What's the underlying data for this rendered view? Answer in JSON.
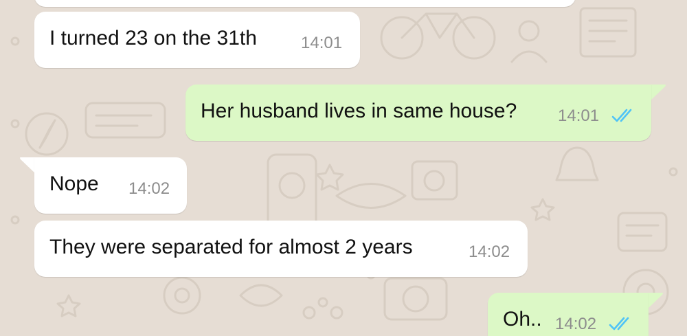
{
  "messages": [
    {
      "direction": "in",
      "text": "I turned 23 on the 31th",
      "time": "14:01"
    },
    {
      "direction": "out",
      "text": "Her husband lives in same house?",
      "time": "14:01",
      "status": "read"
    },
    {
      "direction": "in",
      "text": "Nope",
      "time": "14:02"
    },
    {
      "direction": "in",
      "text": "They were separated for almost 2 years",
      "time": "14:02"
    },
    {
      "direction": "out",
      "text": "Oh..",
      "time": "14:02",
      "status": "read"
    }
  ],
  "colors": {
    "wallpaper": "#e6ddd4",
    "incoming_bubble": "#ffffff",
    "outgoing_bubble": "#dcf8c6",
    "read_ticks": "#4fc3f7",
    "timestamp": "#8d8d8d"
  },
  "icons": {
    "read_receipt": "double-check-icon"
  }
}
